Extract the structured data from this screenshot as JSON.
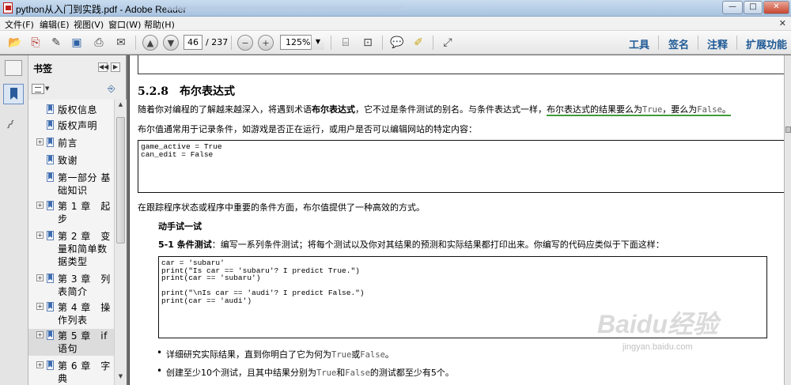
{
  "window": {
    "title": "python从入门到实践.pdf - Adobe Reader"
  },
  "menubar": {
    "items": [
      "文件(F)",
      "编辑(E)",
      "视图(V)",
      "窗口(W)",
      "帮助(H)"
    ],
    "close_glyph": "✕"
  },
  "toolbar": {
    "current_page": "46",
    "total_pages": "/ 237",
    "zoom": "125%",
    "right_links": [
      "工具",
      "签名",
      "注释",
      "扩展功能"
    ]
  },
  "bookmarks": {
    "title": "书签",
    "items": [
      {
        "label": "版权信息",
        "expandable": false
      },
      {
        "label": "版权声明",
        "expandable": false
      },
      {
        "label": "前言",
        "expandable": true
      },
      {
        "label": "致谢",
        "expandable": false
      },
      {
        "label": "第一部分 基础知识",
        "expandable": false
      },
      {
        "label": "第 1 章　起步",
        "expandable": true
      },
      {
        "label": "第 2 章　变量和简单数据类型",
        "expandable": true
      },
      {
        "label": "第 3 章　列表简介",
        "expandable": true
      },
      {
        "label": "第 4 章　操作列表",
        "expandable": true
      },
      {
        "label": "第 5 章　if 语句",
        "expandable": true,
        "selected": true
      },
      {
        "label": "第 6 章　字典",
        "expandable": true
      }
    ]
  },
  "document": {
    "section_number": "5.2.8",
    "section_title": "布尔表达式",
    "para1_a": "随着你对编程的了解越来越深入，将遇到术语",
    "para1_bold": "布尔表达式",
    "para1_b": "，它不过是条件测试的别名。与条件表达式一样，",
    "para1_ul_a": "布尔表达式的结果要么为",
    "para1_true": "True",
    "para1_ul_b": "，要么为",
    "para1_false": "False",
    "para1_ul_c": "。",
    "para2": "布尔值通常用于记录条件，如游戏是否正在运行，或用户是否可以编辑网站的特定内容：",
    "code1": "game_active = True\ncan_edit = False",
    "para3": "在跟踪程序状态或程序中重要的条件方面，布尔值提供了一种高效的方式。",
    "try_heading": "动手试一试",
    "ex_label": "5-1 条件测试",
    "ex_text": "：编写一系列条件测试；将每个测试以及你对其结果的预测和实际结果都打印出来。你编写的代码应类似于下面这样：",
    "code2": "car = 'subaru'\nprint(\"Is car == 'subaru'? I predict True.\")\nprint(car == 'subaru')\n\nprint(\"\\nIs car == 'audi'? I predict False.\")\nprint(car == 'audi')",
    "b1_a": "详细研究实际结果，直到你明白了它为何为",
    "b1_true": "True",
    "b1_or": "或",
    "b1_false": "False",
    "b1_end": "。",
    "b2_a": "创建至少10个测试，且其中结果分别为",
    "b2_true": "True",
    "b2_and": "和",
    "b2_false": "False",
    "b2_end": "的测试都至少有5个。"
  },
  "watermark": {
    "logo": "Baidu经验",
    "url": "jingyan.baidu.com"
  }
}
